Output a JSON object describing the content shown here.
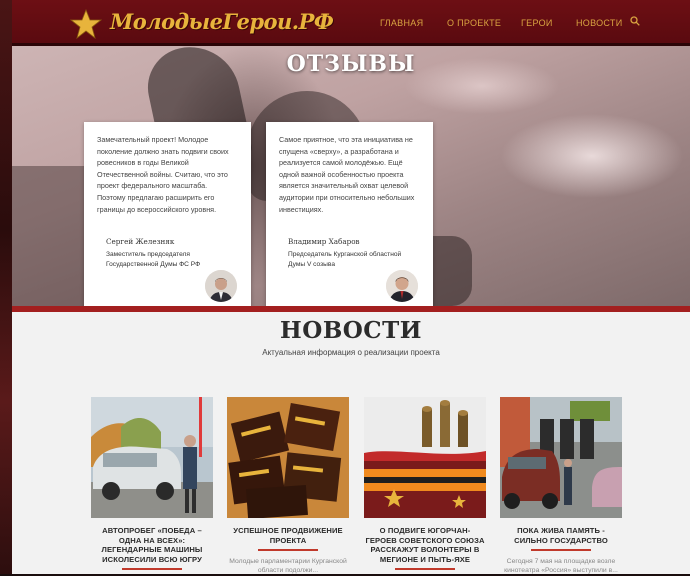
{
  "header": {
    "logo_text": "МолодыеГерои.РФ",
    "nav": {
      "home": "Главная",
      "about": "О проекте",
      "heroes": "Герои",
      "news": "Новости"
    }
  },
  "reviews": {
    "title": "ОТЗЫВЫ",
    "cards": [
      {
        "text": "Замечательный проект! Молодое поколение должно знать подвиги своих ровесников в годы Великой Отечественной войны. Считаю, что это проект федерального масштаба. Поэтому предлагаю расширить его границы до всероссийского уровня.",
        "name": "Сергей Железняк",
        "role": "Заместитель председателя Государственной Думы ФС РФ"
      },
      {
        "text": "Самое приятное, что эта инициатива не спущена «сверху», а разработана и реализуется самой молодёжью. Ещё одной важной особенностью проекта является значительный охват целевой аудитории при относительно небольших инвестициях.",
        "name": "Владимир Хабаров",
        "role": "Председатель Курганской областной Думы V созыва"
      }
    ]
  },
  "news": {
    "title": "НОВОСТИ",
    "subtitle": "Актуальная информация о реализации проекта",
    "items": [
      {
        "headline": "Автопробег «Победа – одна на всех»: легендарные машины исколесили всю Югру",
        "excerpt": ""
      },
      {
        "headline": "Успешное продвижение проекта",
        "excerpt": "Молодые парламентарии Курганской области подолжи..."
      },
      {
        "headline": "О подвиге югорчан-Героев Советского Союза расскажут волонтеры в Мегионе и Пыть-Яхе",
        "excerpt": ""
      },
      {
        "headline": "Пока жива память - сильно государство",
        "excerpt": "Сегодня 7 мая на площадке возле кинотеатра «Россия» выступили в..."
      }
    ]
  },
  "colors": {
    "header_bg": "#6d0f14",
    "accent_gold": "#e8b43c",
    "nav_text": "#d9a441",
    "news_rule": "#c0392b"
  }
}
